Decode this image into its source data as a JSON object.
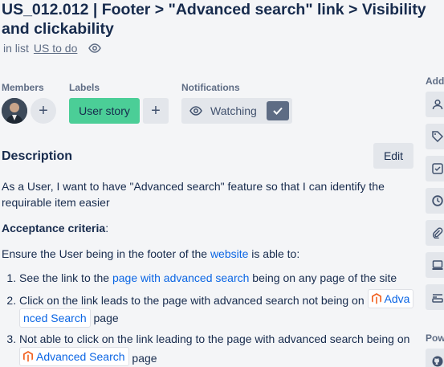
{
  "card": {
    "title": "US_012.012 | Footer > \"Advanced search\" link > Visibility and clickability",
    "in_list_prefix": "in list",
    "list_name": "US to do"
  },
  "members": {
    "label": "Members"
  },
  "labels": {
    "label": "Labels",
    "items": [
      {
        "text": "User story",
        "color": "#4bce97"
      }
    ]
  },
  "notifications": {
    "label": "Notifications",
    "button": "Watching"
  },
  "description": {
    "heading": "Description",
    "edit": "Edit",
    "intro": "As a User, I want to have \"Advanced search\" feature so that I can identify the requirable item easier",
    "criteria_label": "Acceptance criteria",
    "criteria_suffix": ":",
    "ensure_prefix": "Ensure the User being in the footer of the ",
    "ensure_link": "website",
    "ensure_suffix": " is able to:",
    "item1_prefix": "See the link to the ",
    "item1_link": "page with advanced search",
    "item1_suffix": " being on any page of the site",
    "item2_prefix": "Click on the link leads to the page with advanced search not being on ",
    "item2_chip_a": "Adva",
    "item2_chip_b": "nced Search",
    "item2_suffix": " page",
    "item3_prefix": "Not able to click on the link leading to the page with advanced search being on ",
    "item3_chip": "Advanced Search",
    "item3_suffix": " page"
  },
  "sidebar": {
    "add_label": "Add",
    "power_label": "Pow"
  },
  "colors": {
    "accent": "#0c66e4",
    "label_green": "#4bce97",
    "button_bg": "#e3e6eb"
  }
}
